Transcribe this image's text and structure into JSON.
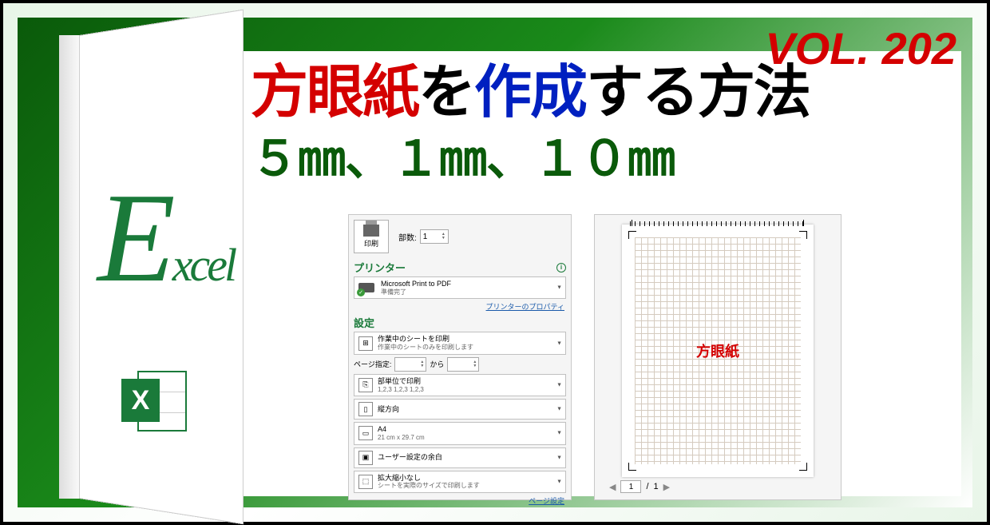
{
  "vol": "VOL. 202",
  "title": {
    "p1": "方眼紙",
    "p2": "を",
    "p3": "作成",
    "p4": "する方法",
    "sizes_line": "５㎜、１㎜、１０㎜",
    "brand_big": "E",
    "brand_rest": "xcel",
    "icon_x": "X"
  },
  "print": {
    "print_label": "印刷",
    "copies_label": "部数:",
    "copies_value": "1",
    "printer_section": "プリンター",
    "printer_name": "Microsoft Print to PDF",
    "printer_status": "準備完了",
    "printer_props_link": "プリンターのプロパティ",
    "settings_section": "設定",
    "scope_title": "作業中のシートを印刷",
    "scope_sub": "作業中のシートのみを印刷します",
    "page_range_label": "ページ指定:",
    "page_range_from": "",
    "page_range_to_label": "から",
    "page_range_to": "",
    "collate_title": "部単位で印刷",
    "collate_sub": "1,2,3   1,2,3   1,2,3",
    "orientation": "縦方向",
    "paper_title": "A4",
    "paper_sub": "21 cm x 29.7 cm",
    "margins": "ユーザー設定の余白",
    "scaling_title": "拡大縮小なし",
    "scaling_sub": "シートを実際のサイズで印刷します",
    "page_setup_link": "ページ設定"
  },
  "preview": {
    "grid_label": "方眼紙",
    "page_current": "1",
    "page_sep": " / ",
    "page_total": "1"
  }
}
